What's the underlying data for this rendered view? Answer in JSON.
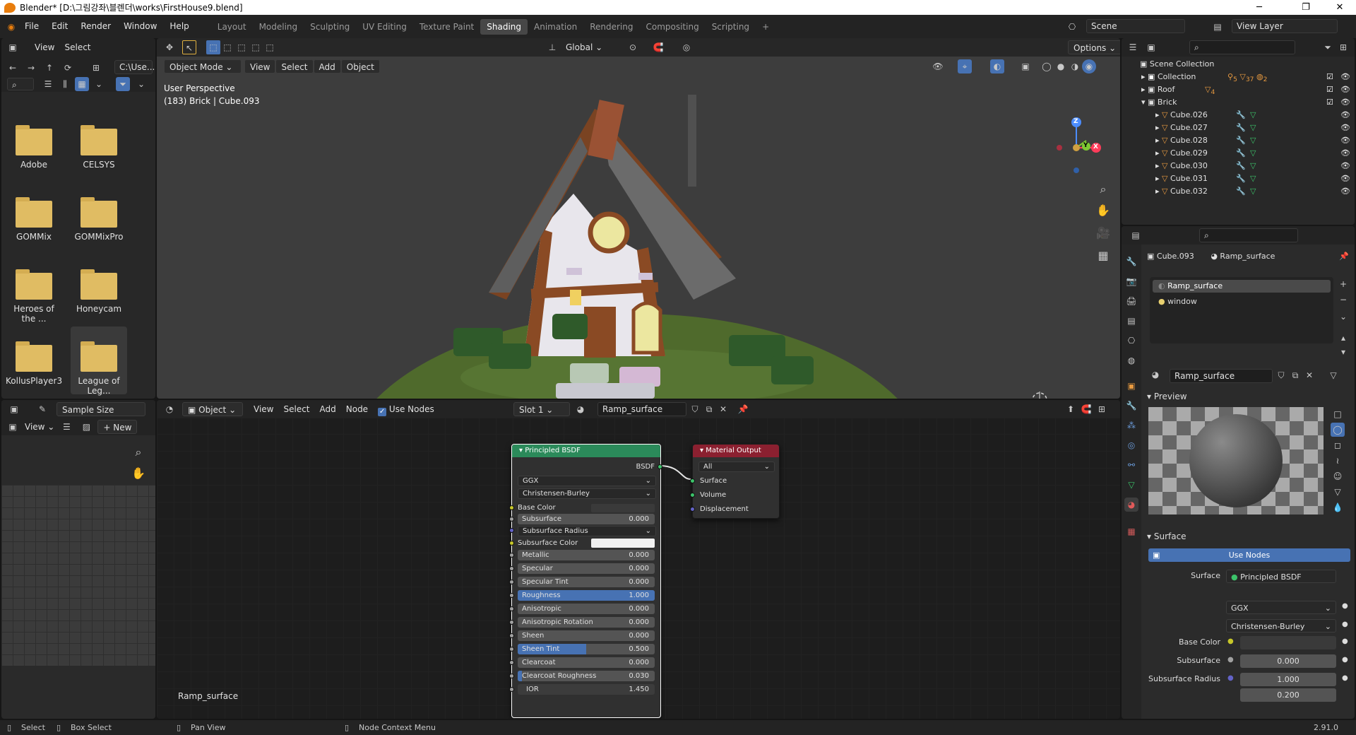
{
  "window": {
    "title": "Blender* [D:\\그림강좌\\블렌더\\works\\FirstHouse9.blend]",
    "min": "─",
    "max": "❐",
    "close": "✕"
  },
  "menu": [
    "File",
    "Edit",
    "Render",
    "Window",
    "Help"
  ],
  "workspaces": [
    "Layout",
    "Modeling",
    "Sculpting",
    "UV Editing",
    "Texture Paint",
    "Shading",
    "Animation",
    "Rendering",
    "Compositing",
    "Scripting"
  ],
  "workspace_add": "+",
  "scene": {
    "name": "Scene",
    "view_layer": "View Layer"
  },
  "filebrowser": {
    "view": "View",
    "select": "Select",
    "path": "C:\\Use...",
    "folders": [
      "Adobe",
      "CELSYS",
      "GOMMix",
      "GOMMixPro",
      "Heroes of the ...",
      "Honeycam",
      "KollusPlayer3",
      "League of Leg..."
    ]
  },
  "viewport": {
    "mode": "Object Mode",
    "menus": [
      "View",
      "Select",
      "Add",
      "Object"
    ],
    "orientation": "Global",
    "options": "Options",
    "overlay_line1": "User Perspective",
    "overlay_line2": "(183) Brick | Cube.093",
    "axis_z": "Z",
    "axis_y": "Y",
    "axis_x": "X"
  },
  "image_editor": {
    "sample_size": "Sample Size",
    "view": "View",
    "new": "New"
  },
  "node_editor": {
    "type": "Object",
    "menus": [
      "View",
      "Select",
      "Add",
      "Node"
    ],
    "use_nodes": "Use Nodes",
    "slot": "Slot 1",
    "material": "Ramp_surface",
    "footer_label": "Ramp_surface"
  },
  "bsdf": {
    "title": "Principled BSDF",
    "output": "BSDF",
    "distribution": "GGX",
    "subsurface_method": "Christensen-Burley",
    "base_color": "Base Color",
    "subsurface_color": "Subsurface Color",
    "subsurface_radius": "Subsurface Radius",
    "sliders": [
      {
        "label": "Subsurface",
        "value": "0.000"
      },
      {
        "label": "Metallic",
        "value": "0.000"
      },
      {
        "label": "Specular",
        "value": "0.000"
      },
      {
        "label": "Specular Tint",
        "value": "0.000"
      },
      {
        "label": "Roughness",
        "value": "1.000",
        "fill": 1.0
      },
      {
        "label": "Anisotropic",
        "value": "0.000"
      },
      {
        "label": "Anisotropic Rotation",
        "value": "0.000"
      },
      {
        "label": "Sheen",
        "value": "0.000"
      },
      {
        "label": "Sheen Tint",
        "value": "0.500",
        "fill": 0.5
      },
      {
        "label": "Clearcoat",
        "value": "0.000"
      },
      {
        "label": "Clearcoat Roughness",
        "value": "0.030",
        "fill": 0.03
      },
      {
        "label": "IOR",
        "value": "1.450"
      }
    ]
  },
  "matout": {
    "title": "Material Output",
    "target": "All",
    "inputs": [
      "Surface",
      "Volume",
      "Displacement"
    ]
  },
  "outliner": {
    "root": "Scene Collection",
    "collection": "Collection",
    "collection_badges": [
      "5",
      "37",
      "2"
    ],
    "roof": "Roof",
    "roof_badge": "4",
    "brick": "Brick",
    "items": [
      "Cube.026",
      "Cube.027",
      "Cube.028",
      "Cube.029",
      "Cube.030",
      "Cube.031",
      "Cube.032"
    ]
  },
  "properties": {
    "object": "Cube.093",
    "material": "Ramp_surface",
    "slots": [
      "Ramp_surface",
      "window"
    ],
    "mat_field": "Ramp_surface",
    "preview": "Preview",
    "surface_panel": "Surface",
    "use_nodes": "Use Nodes",
    "surface_label": "Surface",
    "surface_value": "Principled BSDF",
    "ggx": "GGX",
    "cb": "Christensen-Burley",
    "base_color": "Base Color",
    "subsurface": "Subsurface",
    "subsurface_value": "0.000",
    "subsurface_radius": "Subsurface Radius",
    "radius1": "1.000",
    "radius2": "0.200"
  },
  "status": {
    "select": "Select",
    "box_select": "Box Select",
    "pan": "Pan View",
    "ctx": "Node Context Menu",
    "version": "2.91.0"
  },
  "colors": {
    "accent": "#4772b3",
    "bsdf_header": "#2b8a5a",
    "output_header": "#8b2030"
  }
}
